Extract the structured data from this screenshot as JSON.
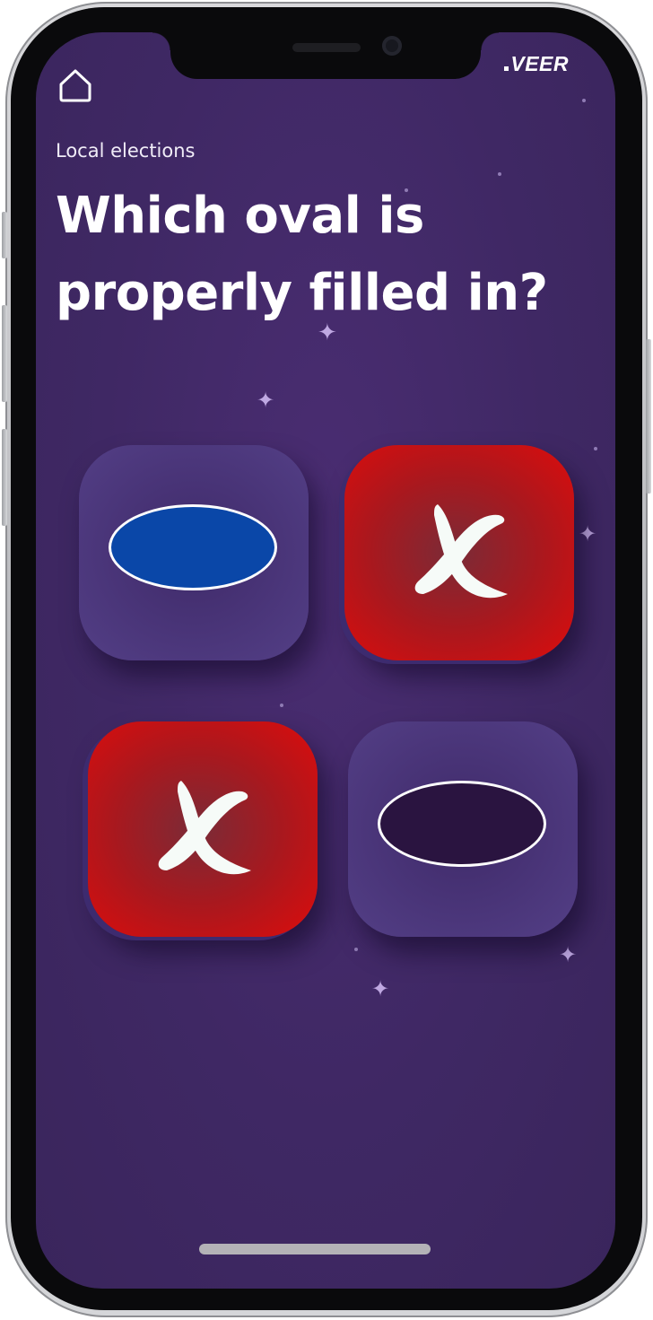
{
  "header": {
    "home_icon": "home-icon",
    "brand": "VEER"
  },
  "subtitle": "Local elections",
  "question": "Which oval is properly filled in?",
  "options": [
    {
      "kind": "oval",
      "state": "filled",
      "color": "#0a47a8"
    },
    {
      "kind": "x-mark",
      "state": "wrong",
      "color": "#dd0c0c"
    },
    {
      "kind": "x-mark",
      "state": "wrong",
      "color": "#dd0c0c"
    },
    {
      "kind": "oval",
      "state": "empty",
      "color": "#2a1440"
    }
  ],
  "colors": {
    "background": "#3f2864",
    "tile": "#4a3579",
    "wrong_tile": "#dd0c0c",
    "text": "#ffffff"
  }
}
